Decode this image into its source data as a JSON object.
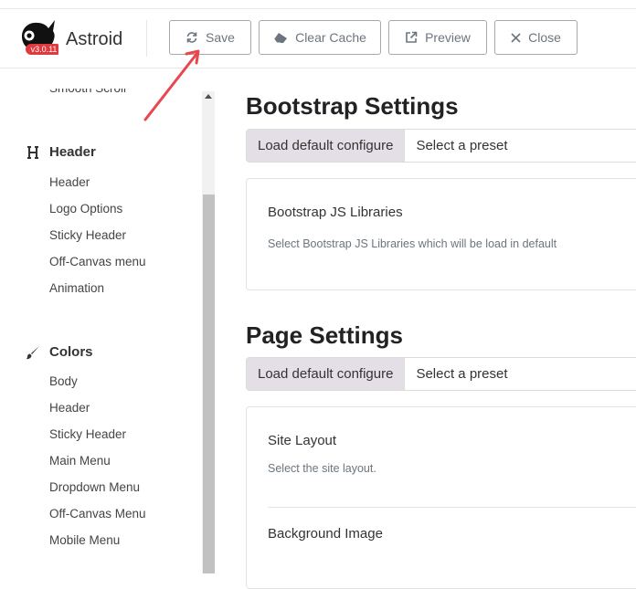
{
  "app": {
    "name": "Astroid",
    "version": "v3.0.11"
  },
  "toolbar": {
    "save_label": "Save",
    "clear_cache_label": "Clear Cache",
    "preview_label": "Preview",
    "close_label": "Close"
  },
  "sidebar": {
    "partial_item": "Smooth Scroll",
    "sections": [
      {
        "title": "Header",
        "icon": "heading-icon",
        "items": [
          "Header",
          "Logo Options",
          "Sticky Header",
          "Off-Canvas menu",
          "Animation"
        ]
      },
      {
        "title": "Colors",
        "icon": "paint-brush-icon",
        "items": [
          "Body",
          "Header",
          "Sticky Header",
          "Main Menu",
          "Dropdown Menu",
          "Off-Canvas Menu",
          "Mobile Menu"
        ]
      }
    ]
  },
  "main": {
    "bootstrap": {
      "title": "Bootstrap Settings",
      "load_default": "Load default configure",
      "select_preset": "Select a preset",
      "field_label": "Bootstrap JS Libraries",
      "field_desc": "Select Bootstrap JS Libraries which will be load in default"
    },
    "page": {
      "title": "Page Settings",
      "load_default": "Load default configure",
      "select_preset": "Select a preset",
      "site_layout_label": "Site Layout",
      "site_layout_desc": "Select the site layout.",
      "bg_image_label": "Background Image"
    }
  },
  "colors": {
    "annotation_arrow": "#e8474f",
    "version_badge": "#e03a3e",
    "preset_bg": "#e4dfe6"
  }
}
